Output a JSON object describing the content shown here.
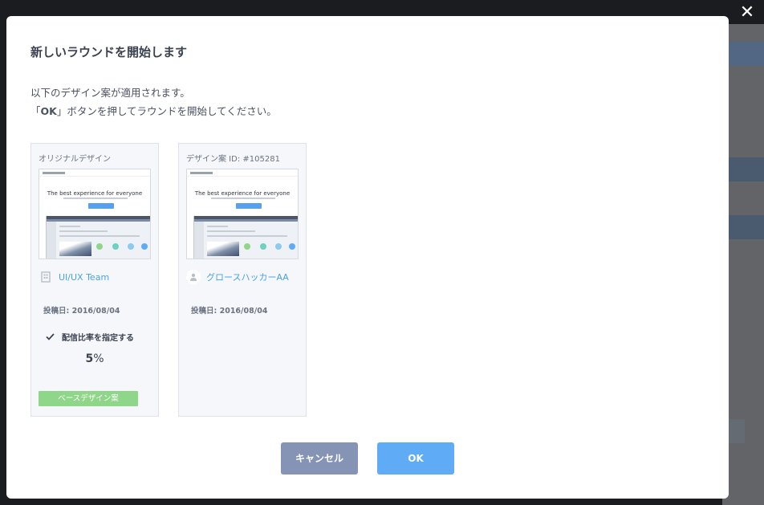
{
  "modal": {
    "title": "新しいラウンドを開始します",
    "description_line1": "以下のデザイン案が適用されます。",
    "description_line2_prefix": "「",
    "description_line2_ok": "OK",
    "description_line2_suffix": "」ボタンを押してラウンドを開始してください。",
    "close_icon": "close-icon"
  },
  "cards": [
    {
      "label": "オリジナルデザイン",
      "thumbnail_headline": "The best experience for everyone",
      "owner_icon": "building-icon",
      "owner": "UI/UX Team",
      "posted": "投稿日: 2016/08/04",
      "ratio_label": "配信比率を指定する",
      "ratio_value": "5",
      "ratio_unit": "%",
      "badge": "ベースデザイン案"
    },
    {
      "label": "デザイン案 ID: #105281",
      "thumbnail_headline": "The best experience for everyone",
      "owner_icon": "person-icon",
      "owner": "グロースハッカーAA",
      "posted": "投稿日: 2016/08/04"
    }
  ],
  "buttons": {
    "cancel": "キャンセル",
    "ok": "OK"
  },
  "colors": {
    "link": "#4aa3e8",
    "ok_button": "#5fabf5",
    "cancel_button": "#8593b5",
    "badge": "#8fd68b"
  }
}
